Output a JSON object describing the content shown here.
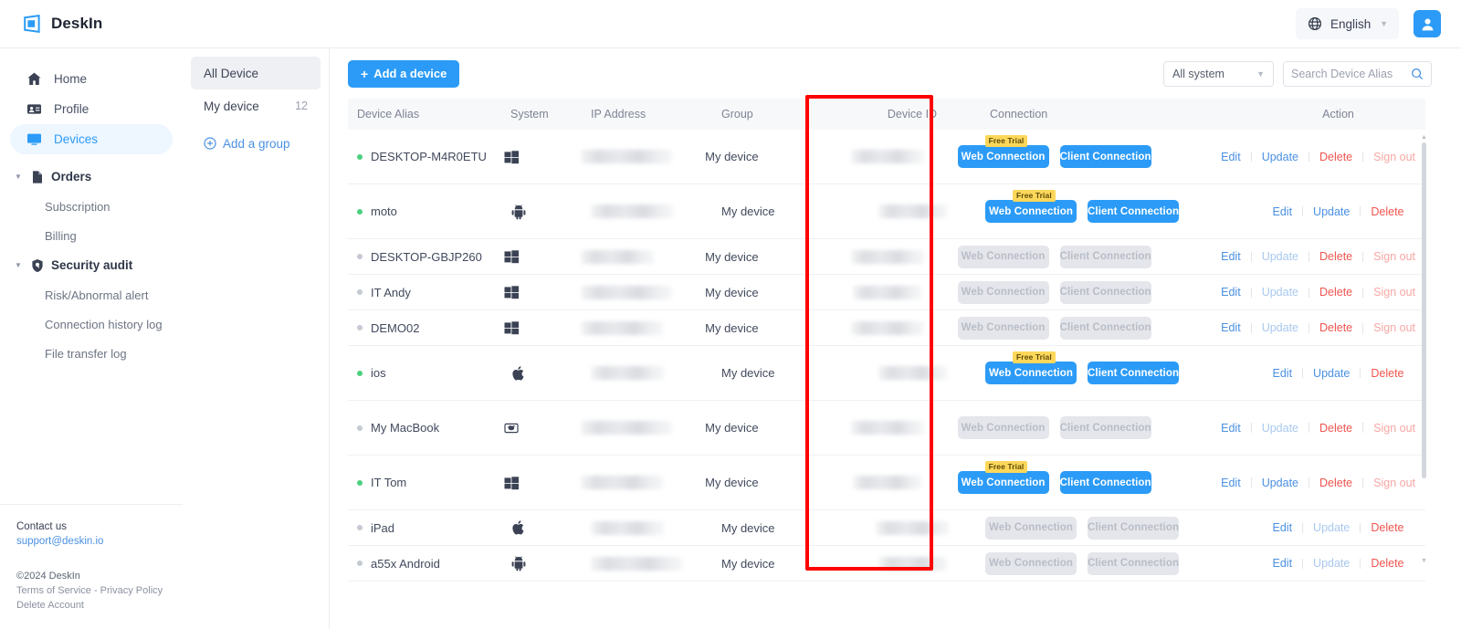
{
  "header": {
    "brand": "DeskIn",
    "logo_icon": "deskin-logo-icon",
    "language": "English",
    "language_icon": "globe-icon",
    "caret_icon": "chevron-down-icon",
    "account_icon": "user-avatar-icon"
  },
  "sidebar": {
    "items": [
      {
        "label": "Home",
        "icon": "home-icon",
        "type": "item",
        "active": false
      },
      {
        "label": "Profile",
        "icon": "id-card-icon",
        "type": "item",
        "active": false
      },
      {
        "label": "Devices",
        "icon": "monitor-icon",
        "type": "item",
        "active": true
      },
      {
        "label": "Orders",
        "icon": "document-icon",
        "type": "group"
      },
      {
        "label": "Subscription",
        "type": "sub"
      },
      {
        "label": "Billing",
        "type": "sub"
      },
      {
        "label": "Security audit",
        "icon": "shield-search-icon",
        "type": "group"
      },
      {
        "label": "Risk/Abnormal alert",
        "type": "sub"
      },
      {
        "label": "Connection history log",
        "type": "sub"
      },
      {
        "label": "File transfer log",
        "type": "sub"
      }
    ],
    "footer": {
      "contact_title": "Contact us",
      "contact_email": "support@deskin.io",
      "copyright": "©2024 DeskIn",
      "legal_links": "Terms of Service - Privacy Policy",
      "delete_account": "Delete Account"
    }
  },
  "groups": {
    "items": [
      {
        "label": "All Device",
        "count": "",
        "selected": true
      },
      {
        "label": "My device",
        "count": "12",
        "selected": false
      }
    ],
    "add_group_label": "Add a group",
    "add_group_icon": "plus-circle-icon"
  },
  "toolbar": {
    "add_device_label": "Add a device",
    "add_device_icon": "plus-icon",
    "system_filter_value": "All system",
    "system_filter_caret": "chevron-down-icon",
    "search_placeholder": "Search Device Alias",
    "search_value": "",
    "search_icon": "search-icon"
  },
  "table": {
    "columns": [
      "Device Alias",
      "System",
      "IP Address",
      "Group",
      "Device ID",
      "Connection",
      "Action"
    ],
    "labels": {
      "web_connection": "Web Connection",
      "client_connection": "Client Connection",
      "free_trial": "Free Trial",
      "edit": "Edit",
      "update": "Update",
      "delete": "Delete",
      "sign_out": "Sign out"
    },
    "rows": [
      {
        "alias": "DESKTOP-M4R0ETU",
        "online": true,
        "os": "windows-icon",
        "group": "My device",
        "tall": true,
        "conn_enabled": true,
        "free_trial": true,
        "sign_out": true
      },
      {
        "alias": "moto",
        "online": true,
        "os": "android-icon",
        "group": "My device",
        "tall": true,
        "conn_enabled": true,
        "free_trial": true,
        "sign_out": false
      },
      {
        "alias": "DESKTOP-GBJP260",
        "online": false,
        "os": "windows-icon",
        "group": "My device",
        "tall": false,
        "conn_enabled": false,
        "free_trial": false,
        "sign_out": true
      },
      {
        "alias": "IT Andy",
        "online": false,
        "os": "windows-icon",
        "group": "My device",
        "tall": false,
        "conn_enabled": false,
        "free_trial": false,
        "sign_out": true
      },
      {
        "alias": "DEMO02",
        "online": false,
        "os": "windows-icon",
        "group": "My device",
        "tall": false,
        "conn_enabled": false,
        "free_trial": false,
        "sign_out": true
      },
      {
        "alias": "ios",
        "online": true,
        "os": "apple-icon",
        "group": "My device",
        "tall": true,
        "conn_enabled": true,
        "free_trial": true,
        "sign_out": false
      },
      {
        "alias": "My MacBook",
        "online": false,
        "os": "macbook-icon",
        "group": "My device",
        "tall": true,
        "conn_enabled": false,
        "free_trial": false,
        "sign_out": true
      },
      {
        "alias": "IT Tom",
        "online": true,
        "os": "windows-icon",
        "group": "My device",
        "tall": true,
        "conn_enabled": true,
        "free_trial": true,
        "sign_out": true
      },
      {
        "alias": "iPad",
        "online": false,
        "os": "apple-icon",
        "group": "My device",
        "tall": false,
        "conn_enabled": false,
        "free_trial": false,
        "sign_out": false
      },
      {
        "alias": "a55x Android",
        "online": false,
        "os": "android-icon",
        "group": "My device",
        "tall": false,
        "conn_enabled": false,
        "free_trial": false,
        "sign_out": false
      }
    ]
  },
  "annotation": {
    "highlight_color": "#fe0000",
    "highlighted_column": "Device ID"
  }
}
